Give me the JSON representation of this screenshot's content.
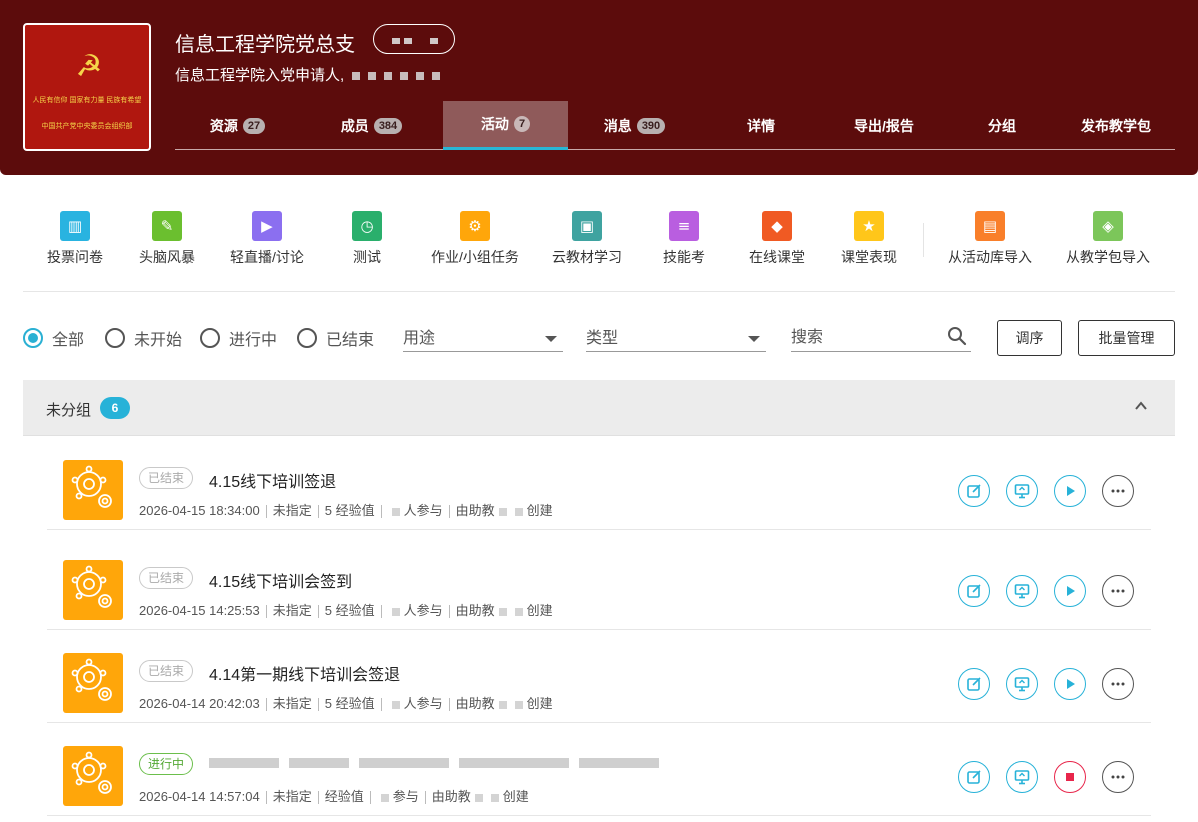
{
  "header": {
    "course_title": "信息工程学院党总支",
    "course_subtitle": "信息工程学院入党申请人,",
    "cover": {
      "emblem": "☭",
      "slogan_top": "人民有信仰 国家有力量 民族有希望",
      "slogan_bottom": "中国共产党中央委员会组织部"
    },
    "tabs": [
      {
        "label": "资源",
        "badge": "27",
        "active": false
      },
      {
        "label": "成员",
        "badge": "384",
        "active": false
      },
      {
        "label": "活动",
        "badge": "7",
        "active": true
      },
      {
        "label": "消息",
        "badge": "390",
        "active": false
      },
      {
        "label": "详情",
        "badge": "",
        "active": false
      },
      {
        "label": "导出/报告",
        "badge": "",
        "active": false
      },
      {
        "label": "分组",
        "badge": "",
        "active": false
      },
      {
        "label": "发布教学包",
        "badge": "",
        "active": false
      }
    ]
  },
  "toolbar": {
    "tools": [
      {
        "label": "投票问卷",
        "icon": "poll-chart-icon",
        "color": "#29b3e0",
        "glyph": "▥"
      },
      {
        "label": "头脑风暴",
        "icon": "brainstorm-bubble-icon",
        "color": "#6bbf2f",
        "glyph": "✎"
      },
      {
        "label": "轻直播/讨论",
        "icon": "live-discussion-icon",
        "color": "#8b6ff0",
        "glyph": "▶"
      },
      {
        "label": "测试",
        "icon": "quiz-icon",
        "color": "#2aaf6c",
        "glyph": "◷"
      },
      {
        "label": "作业/小组任务",
        "icon": "homework-gear-icon",
        "color": "#ffa60a",
        "glyph": "⚙"
      },
      {
        "label": "云教材学习",
        "icon": "cloud-textbook-icon",
        "color": "#3fa3a0",
        "glyph": "▣"
      },
      {
        "label": "技能考",
        "icon": "skill-exam-icon",
        "color": "#b95ee0",
        "glyph": "≡"
      },
      {
        "label": "在线课堂",
        "icon": "online-class-icon",
        "color": "#f05a23",
        "glyph": "◆"
      },
      {
        "label": "课堂表现",
        "icon": "class-performance-icon",
        "color": "#ffc61a",
        "glyph": "★"
      },
      {
        "label": "从活动库导入",
        "icon": "import-library-icon",
        "color": "#f97f2a",
        "glyph": "▤"
      },
      {
        "label": "从教学包导入",
        "icon": "import-package-icon",
        "color": "#7cc65a",
        "glyph": "◈"
      }
    ]
  },
  "filters": {
    "radios": [
      {
        "label": "全部",
        "checked": true
      },
      {
        "label": "未开始",
        "checked": false
      },
      {
        "label": "进行中",
        "checked": false
      },
      {
        "label": "已结束",
        "checked": false
      }
    ],
    "purpose_label": "用途",
    "type_label": "类型",
    "search_placeholder": "搜索",
    "reorder_label": "调序",
    "batch_label": "批量管理"
  },
  "group": {
    "name": "未分组",
    "count": "6"
  },
  "activities": [
    {
      "status": "已结束",
      "status_live": false,
      "name": "4.15线下培训签退",
      "datetime": "2026-04-15 18:34:00",
      "assignee": "未指定",
      "exp": "5 经验值",
      "participants": "人参与",
      "creator_prefix": "由助教",
      "creator_suffix": "创建",
      "running": false
    },
    {
      "status": "已结束",
      "status_live": false,
      "name": "4.15线下培训会签到",
      "datetime": "2026-04-15 14:25:53",
      "assignee": "未指定",
      "exp": "5 经验值",
      "participants": "人参与",
      "creator_prefix": "由助教",
      "creator_suffix": "创建",
      "running": false
    },
    {
      "status": "已结束",
      "status_live": false,
      "name": "4.14第一期线下培训会签退",
      "datetime": "2026-04-14 20:42:03",
      "assignee": "未指定",
      "exp": "5 经验值",
      "participants": "人参与",
      "creator_prefix": "由助教",
      "creator_suffix": "创建",
      "running": false
    },
    {
      "status": "进行中",
      "status_live": true,
      "name": "",
      "datetime": "2026-04-14 14:57:04",
      "assignee": "未指定",
      "exp": "经验值",
      "participants": "参与",
      "creator_prefix": "由助教",
      "creator_suffix": "创建",
      "running": true
    }
  ]
}
